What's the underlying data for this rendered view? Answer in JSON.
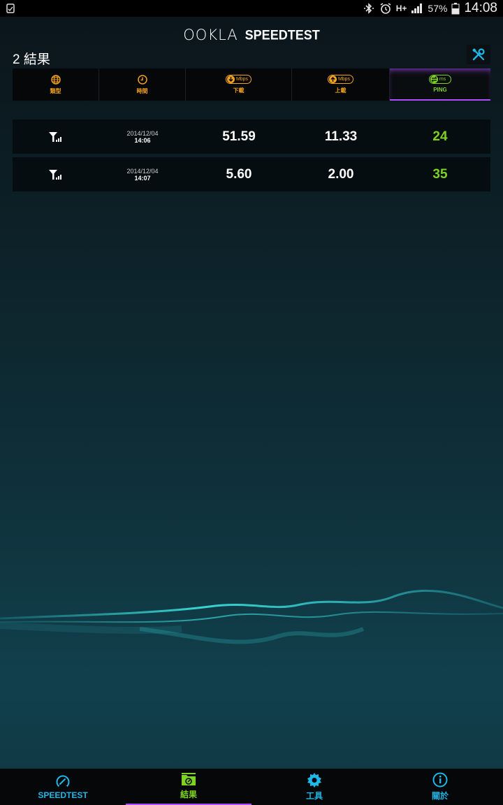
{
  "statusbar": {
    "network": "H+",
    "battery": "57%",
    "time": "14:08"
  },
  "header": {
    "logo_left": "OOKLA",
    "logo_right": "SPEEDTEST"
  },
  "results": {
    "title": "2 結果"
  },
  "columns": {
    "type": "類型",
    "time": "時間",
    "download": "下載",
    "download_unit": "Mbps",
    "upload": "上載",
    "upload_unit": "Mbps",
    "ping": "PING",
    "ping_unit": "ms"
  },
  "rows": [
    {
      "date": "2014/12/04",
      "time": "14:06",
      "download": "51.59",
      "upload": "11.33",
      "ping": "24"
    },
    {
      "date": "2014/12/04",
      "time": "14:07",
      "download": "5.60",
      "upload": "2.00",
      "ping": "35"
    }
  ],
  "nav": {
    "speedtest": "SPEEDTEST",
    "results": "結果",
    "tools": "工具",
    "about": "關於"
  },
  "colors": {
    "accent_orange": "#f3a21a",
    "accent_green": "#7ed321",
    "accent_blue": "#1fb7e8",
    "accent_purple": "#b04cff"
  }
}
